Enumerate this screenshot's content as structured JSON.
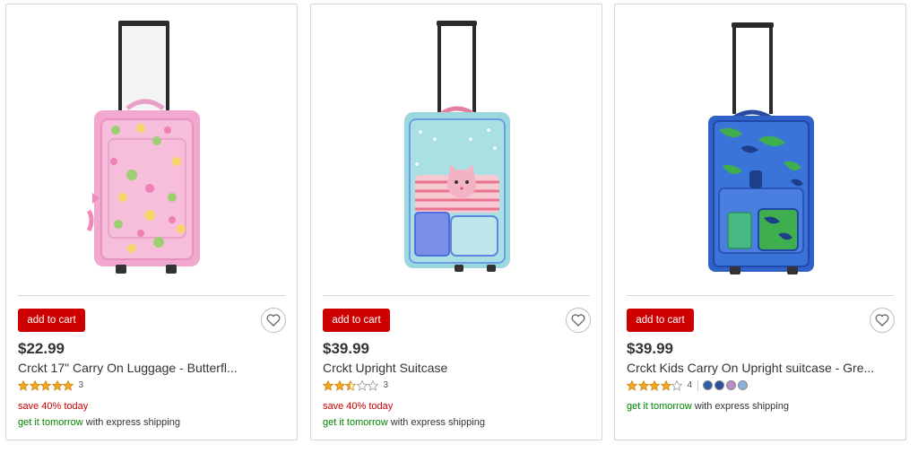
{
  "colors": {
    "brand_red": "#cc0000",
    "shipping_green": "#008300",
    "star_gold": "#f5a623"
  },
  "products": [
    {
      "name": "Crckt 17\" Carry On Luggage - Butterfl...",
      "price": "$22.99",
      "add_to_cart": "add to cart",
      "rating": 5,
      "review_count": "3",
      "promo": "save 40% today",
      "shipping_highlight": "get it tomorrow",
      "shipping_rest": " with express shipping",
      "image": "pink butterfly print rolling suitcase"
    },
    {
      "name": "Crckt Upright Suitcase",
      "price": "$39.99",
      "add_to_cart": "add to cart",
      "rating": 2.5,
      "review_count": "3",
      "promo": "save 40% today",
      "shipping_highlight": "get it tomorrow",
      "shipping_rest": " with express shipping",
      "image": "aqua polka dot suitcase with cat face"
    },
    {
      "name": "Crckt Kids Carry On Upright suitcase - Gre...",
      "price": "$39.99",
      "add_to_cart": "add to cart",
      "rating": 4,
      "review_count": "4",
      "swatches": [
        "#2f5fa8",
        "#2b4f9a",
        "#b98bc8",
        "#8ab0d8"
      ],
      "shipping_highlight": "get it tomorrow",
      "shipping_rest": " with express shipping",
      "image": "blue and green camo suitcase"
    }
  ]
}
